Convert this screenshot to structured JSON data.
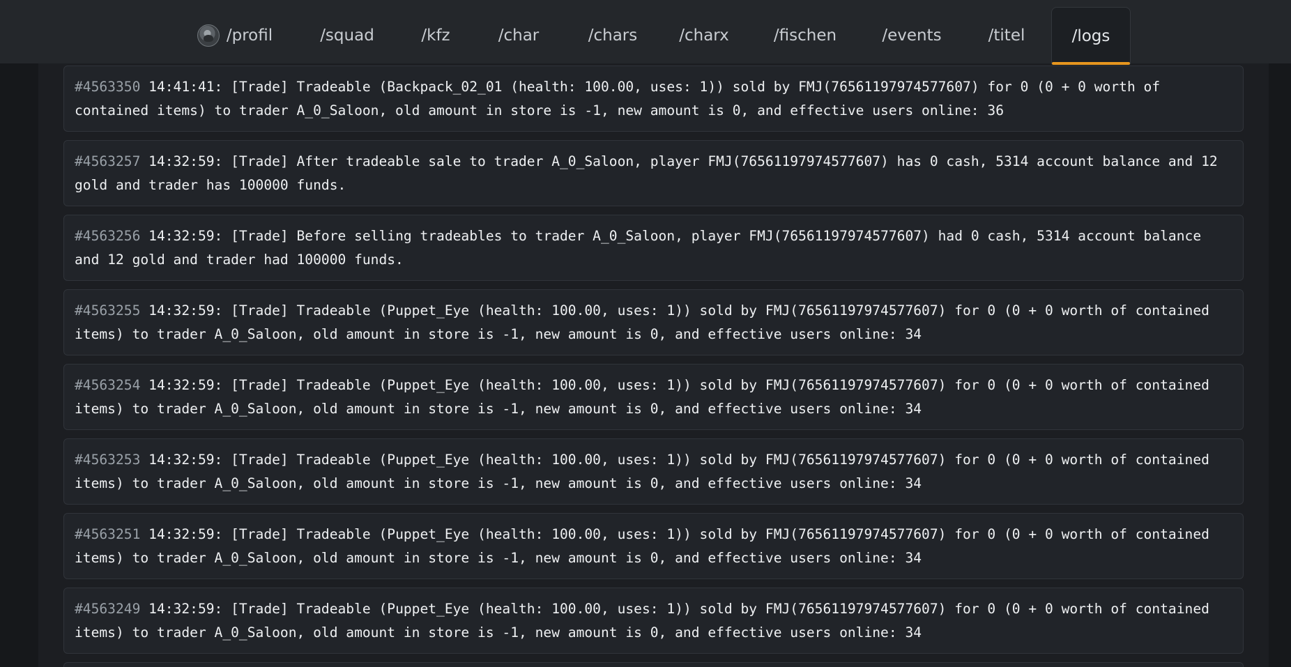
{
  "nav": {
    "items": [
      {
        "label": "/profil",
        "active": false
      },
      {
        "label": "/squad",
        "active": false
      },
      {
        "label": "/kfz",
        "active": false
      },
      {
        "label": "/char",
        "active": false
      },
      {
        "label": "/chars",
        "active": false
      },
      {
        "label": "/charx",
        "active": false
      },
      {
        "label": "/fischen",
        "active": false
      },
      {
        "label": "/events",
        "active": false
      },
      {
        "label": "/titel",
        "active": false
      },
      {
        "label": "/logs",
        "active": true
      }
    ],
    "accent_color": "#e6961f"
  },
  "logs": [
    {
      "id": "#4563350",
      "text": "14:41:41: [Trade] Tradeable (Backpack_02_01 (health: 100.00, uses: 1)) sold by FMJ(76561197974577607) for 0 (0 + 0 worth of contained items) to trader A_0_Saloon, old amount in store is -1, new amount is 0, and effective users online: 36"
    },
    {
      "id": "#4563257",
      "text": "14:32:59: [Trade] After tradeable sale to trader A_0_Saloon, player FMJ(76561197974577607) has 0 cash, 5314 account balance and 12 gold and trader has 100000 funds."
    },
    {
      "id": "#4563256",
      "text": "14:32:59: [Trade] Before selling tradeables to trader A_0_Saloon, player FMJ(76561197974577607) had 0 cash, 5314 account balance and 12 gold and trader had 100000 funds."
    },
    {
      "id": "#4563255",
      "text": "14:32:59: [Trade] Tradeable (Puppet_Eye (health: 100.00, uses: 1)) sold by FMJ(76561197974577607) for 0 (0 + 0 worth of contained items) to trader A_0_Saloon, old amount in store is -1, new amount is 0, and effective users online: 34"
    },
    {
      "id": "#4563254",
      "text": "14:32:59: [Trade] Tradeable (Puppet_Eye (health: 100.00, uses: 1)) sold by FMJ(76561197974577607) for 0 (0 + 0 worth of contained items) to trader A_0_Saloon, old amount in store is -1, new amount is 0, and effective users online: 34"
    },
    {
      "id": "#4563253",
      "text": "14:32:59: [Trade] Tradeable (Puppet_Eye (health: 100.00, uses: 1)) sold by FMJ(76561197974577607) for 0 (0 + 0 worth of contained items) to trader A_0_Saloon, old amount in store is -1, new amount is 0, and effective users online: 34"
    },
    {
      "id": "#4563251",
      "text": "14:32:59: [Trade] Tradeable (Puppet_Eye (health: 100.00, uses: 1)) sold by FMJ(76561197974577607) for 0 (0 + 0 worth of contained items) to trader A_0_Saloon, old amount in store is -1, new amount is 0, and effective users online: 34"
    },
    {
      "id": "#4563249",
      "text": "14:32:59: [Trade] Tradeable (Puppet_Eye (health: 100.00, uses: 1)) sold by FMJ(76561197974577607) for 0 (0 + 0 worth of contained items) to trader A_0_Saloon, old amount in store is -1, new amount is 0, and effective users online: 34"
    }
  ]
}
